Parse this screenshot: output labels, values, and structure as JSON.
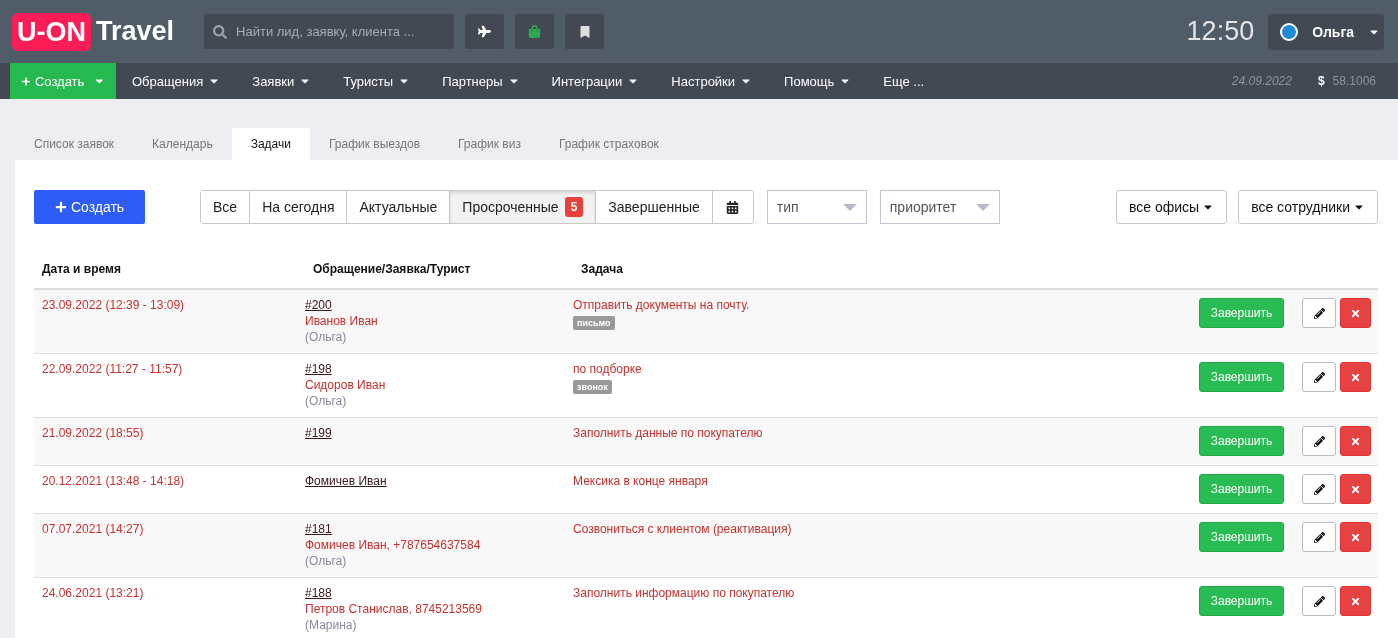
{
  "header": {
    "logo_badge": "U-ON",
    "logo_text": "Travel",
    "search": {
      "placeholder": "Найти лид, заявку, клиента ..."
    },
    "time": "12:50",
    "user": "Ольга"
  },
  "nav": {
    "create": "Создать",
    "items": [
      "Обращения",
      "Заявки",
      "Туристы",
      "Партнеры",
      "Интеграции",
      "Настройки",
      "Помощь"
    ],
    "more": "Еще ...",
    "date": "24.09.2022",
    "currency_sign": "$",
    "rate": "58.1006"
  },
  "tabs": [
    {
      "label": "Список заявок",
      "selected": false
    },
    {
      "label": "Календарь",
      "selected": false
    },
    {
      "label": "Задачи",
      "selected": true
    },
    {
      "label": "График выездов",
      "selected": false
    },
    {
      "label": "График виз",
      "selected": false
    },
    {
      "label": "График страховок",
      "selected": false
    }
  ],
  "toolbar": {
    "create": "Создать",
    "filters": [
      {
        "label": "Все",
        "selected": false
      },
      {
        "label": "На сегодня",
        "selected": false
      },
      {
        "label": "Актуальные",
        "selected": false
      },
      {
        "label": "Просроченные",
        "selected": true,
        "badge": "5"
      },
      {
        "label": "Завершенные",
        "selected": false
      }
    ],
    "type_select": {
      "placeholder": "тип"
    },
    "priority_select": {
      "placeholder": "приоритет"
    },
    "offices": "все офисы",
    "employees": "все сотрудники"
  },
  "table": {
    "columns": [
      "Дата и время",
      "Обращение/Заявка/Турист",
      "Задача"
    ],
    "rows": [
      {
        "date": "23.09.2022 (12:39 - 13:09)",
        "link": "#200",
        "client": "Иванов Иван",
        "manager": "(Ольга)",
        "task": "Отправить документы на почту.",
        "tag": "письмо",
        "action": "Завершить"
      },
      {
        "date": "22.09.2022 (11:27 - 11:57)",
        "link": "#198",
        "client": "Сидоров Иван",
        "manager": "(Ольга)",
        "task": "по подборке",
        "tag": "звонок",
        "action": "Завершить"
      },
      {
        "date": "21.09.2022 (18:55)",
        "link": "#199",
        "task": "Заполнить данные по покупателю",
        "action": "Завершить"
      },
      {
        "date": "20.12.2021 (13:48 - 14:18)",
        "link": "Фомичев Иван",
        "task": "Мексика в конце января",
        "action": "Завершить"
      },
      {
        "date": "07.07.2021 (14:27)",
        "link": "#181",
        "client": "Фомичев Иван, +787654637584",
        "manager": "(Ольга)",
        "task": "Созвониться с клиентом (реактивация)",
        "action": "Завершить"
      },
      {
        "date": "24.06.2021 (13:21)",
        "link": "#188",
        "client": "Петров Станислав, 8745213569",
        "manager": "(Марина)",
        "task": "Заполнить информацию по покупателю",
        "action": "Завершить"
      }
    ]
  }
}
